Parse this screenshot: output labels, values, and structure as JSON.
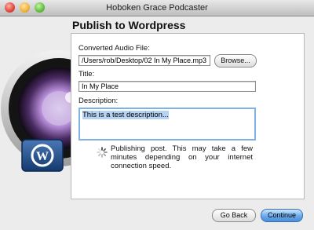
{
  "window": {
    "title": "Hoboken Grace Podcaster"
  },
  "page": {
    "heading": "Publish to Wordpress"
  },
  "form": {
    "audio_file_label": "Converted Audio File:",
    "audio_file_value": "/Users/rob/Desktop/02 In My Place.mp3",
    "browse_label": "Browse...",
    "title_label": "Title:",
    "title_value": "In My Place",
    "description_label": "Description:",
    "description_value": "This is a test description..."
  },
  "status": {
    "message": "Publishing post. This may take a few minutes depending on your internet connection speed."
  },
  "footer": {
    "back_label": "Go Back",
    "continue_label": "Continue"
  },
  "icons": {
    "close": "close-icon",
    "minimize": "minimize-icon",
    "zoom": "zoom-icon",
    "logo": "wordpress-icon",
    "spinner": "spinner-icon"
  }
}
